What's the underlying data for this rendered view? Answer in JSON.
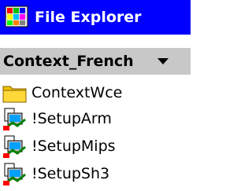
{
  "window": {
    "title": "File Explorer",
    "app_icon": "file-explorer-icon",
    "title_bar_color": "#0000ff"
  },
  "location": {
    "current_folder": "Context_French",
    "dropdown_icon": "chevron-down-icon"
  },
  "files": [
    {
      "name": "ContextWce",
      "type": "folder",
      "icon": "folder-icon"
    },
    {
      "name": "!SetupArm",
      "type": "setup",
      "icon": "setup-program-icon"
    },
    {
      "name": "!SetupMips",
      "type": "setup",
      "icon": "setup-program-icon"
    },
    {
      "name": "!SetupSh3",
      "type": "setup",
      "icon": "setup-program-icon"
    }
  ]
}
